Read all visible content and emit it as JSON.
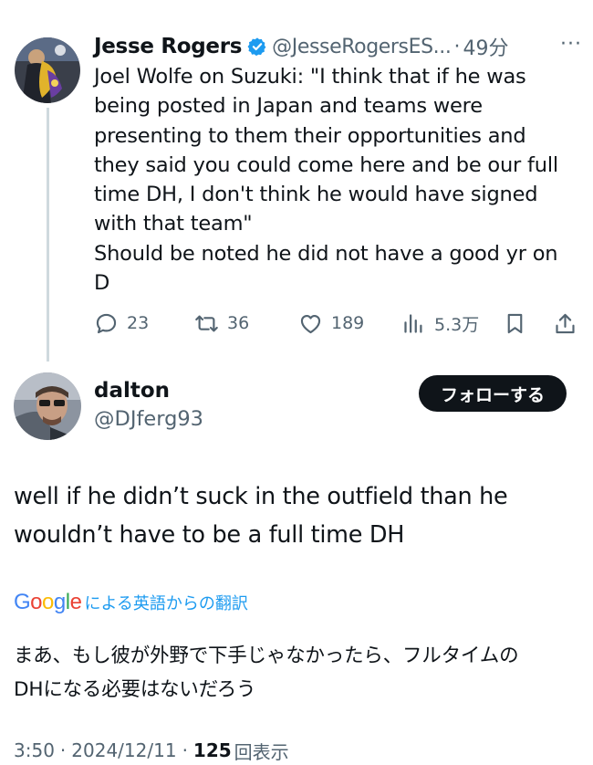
{
  "original_tweet": {
    "author_name": "Jesse Rogers",
    "handle": "@JesseRogersES...",
    "separator": "·",
    "time": "49分",
    "more": "···",
    "text_lines": [
      "Joel Wolfe on Suzuki: \"I think that if he was",
      "being posted in Japan and teams were",
      "presenting to them their opportunities and",
      "they said you could come here and be our full",
      "time DH, I don't think he would have signed",
      "with that team\"",
      "Should be noted he did not have a good yr on",
      "D"
    ],
    "actions": {
      "replies": "23",
      "reposts": "36",
      "likes": "189",
      "views": "5.3万"
    },
    "icons": [
      "verified-badge-icon",
      "reply-icon",
      "repost-icon",
      "like-icon",
      "views-icon",
      "bookmark-icon",
      "share-icon"
    ]
  },
  "reply": {
    "author_name": "dalton",
    "handle": "@DJferg93",
    "follow_label": "フォローする",
    "text_lines": [
      "well if he didn’t suck in the outfield than he",
      "wouldn’t have to be a full time DH"
    ],
    "translation": {
      "google_letters": [
        "G",
        "o",
        "o",
        "g",
        "l",
        "e"
      ],
      "google_colors": [
        "#4285F4",
        "#EA4335",
        "#FBBC05",
        "#4285F4",
        "#34A853",
        "#EA4335"
      ],
      "label": "による英語からの翻訳",
      "text_lines": [
        "まあ、もし彼が外野で下手じゃなかったら、フルタイムの",
        "DHになる必要はないだろう"
      ]
    },
    "meta": {
      "time": "3:50",
      "sep1": "·",
      "date": "2024/12/11",
      "sep2": "·",
      "views_count": "125",
      "views_label": "回表示"
    }
  },
  "colors": {
    "text": "#0f1419",
    "secondary": "#536471",
    "accent": "#1d9bf0",
    "thread_line": "#cfd9de",
    "follow_bg": "#0f1419"
  }
}
